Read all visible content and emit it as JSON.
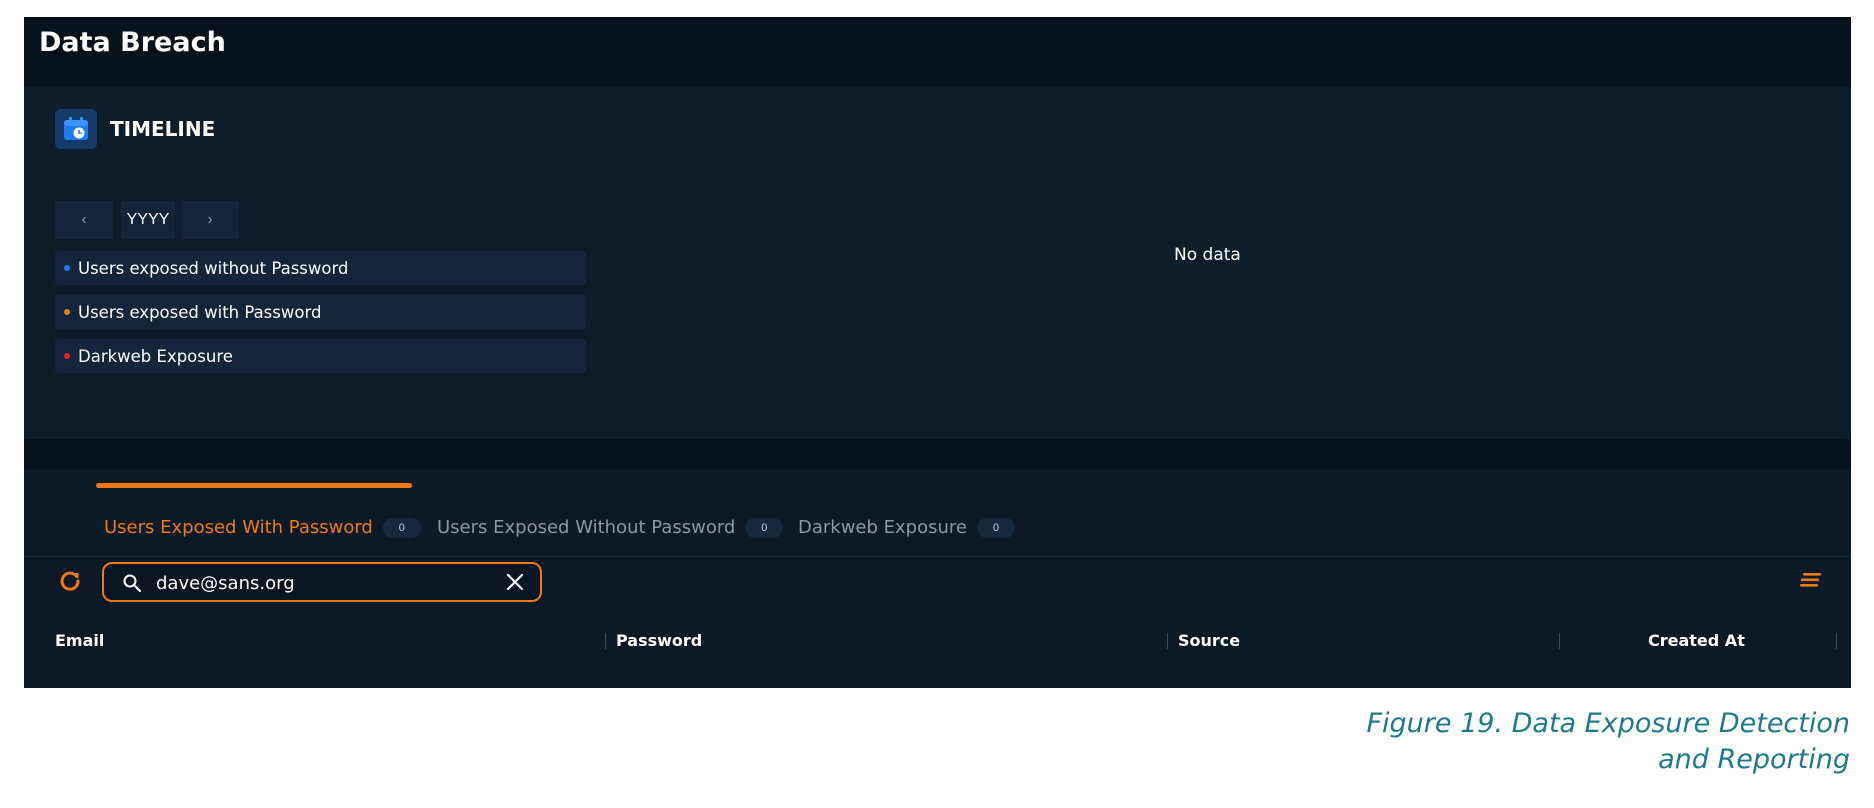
{
  "app": {
    "title": "Data Breach"
  },
  "timeline": {
    "title": "TIMELINE",
    "year_label": "YYYY",
    "prev_glyph": "‹",
    "next_glyph": "›",
    "no_data_text": "No data",
    "legend": [
      {
        "label": "Users exposed without Password",
        "color": "#1e7cf0"
      },
      {
        "label": "Users exposed with Password",
        "color": "#f07a12"
      },
      {
        "label": "Darkweb Exposure",
        "color": "#e5202d"
      }
    ]
  },
  "tabs": [
    {
      "label": "Users Exposed With Password",
      "count": "0",
      "active": true
    },
    {
      "label": "Users Exposed Without Password",
      "count": "0",
      "active": false
    },
    {
      "label": "Darkweb Exposure",
      "count": "0",
      "active": false
    }
  ],
  "search": {
    "value": "dave@sans.org"
  },
  "table": {
    "columns": [
      "Email",
      "Password",
      "Source",
      "Created At"
    ]
  },
  "caption": {
    "line1": "Figure 19. Data Exposure Detection",
    "line2": "and Reporting"
  },
  "colors": {
    "accent": "#f07a12",
    "background": "#0c1a28",
    "panel": "#13253a",
    "caption": "#1d7a8c"
  },
  "icons": [
    "calendar-clock-icon",
    "chevron-left-icon",
    "chevron-right-icon",
    "refresh-icon",
    "search-icon",
    "close-icon",
    "columns-menu-icon"
  ]
}
